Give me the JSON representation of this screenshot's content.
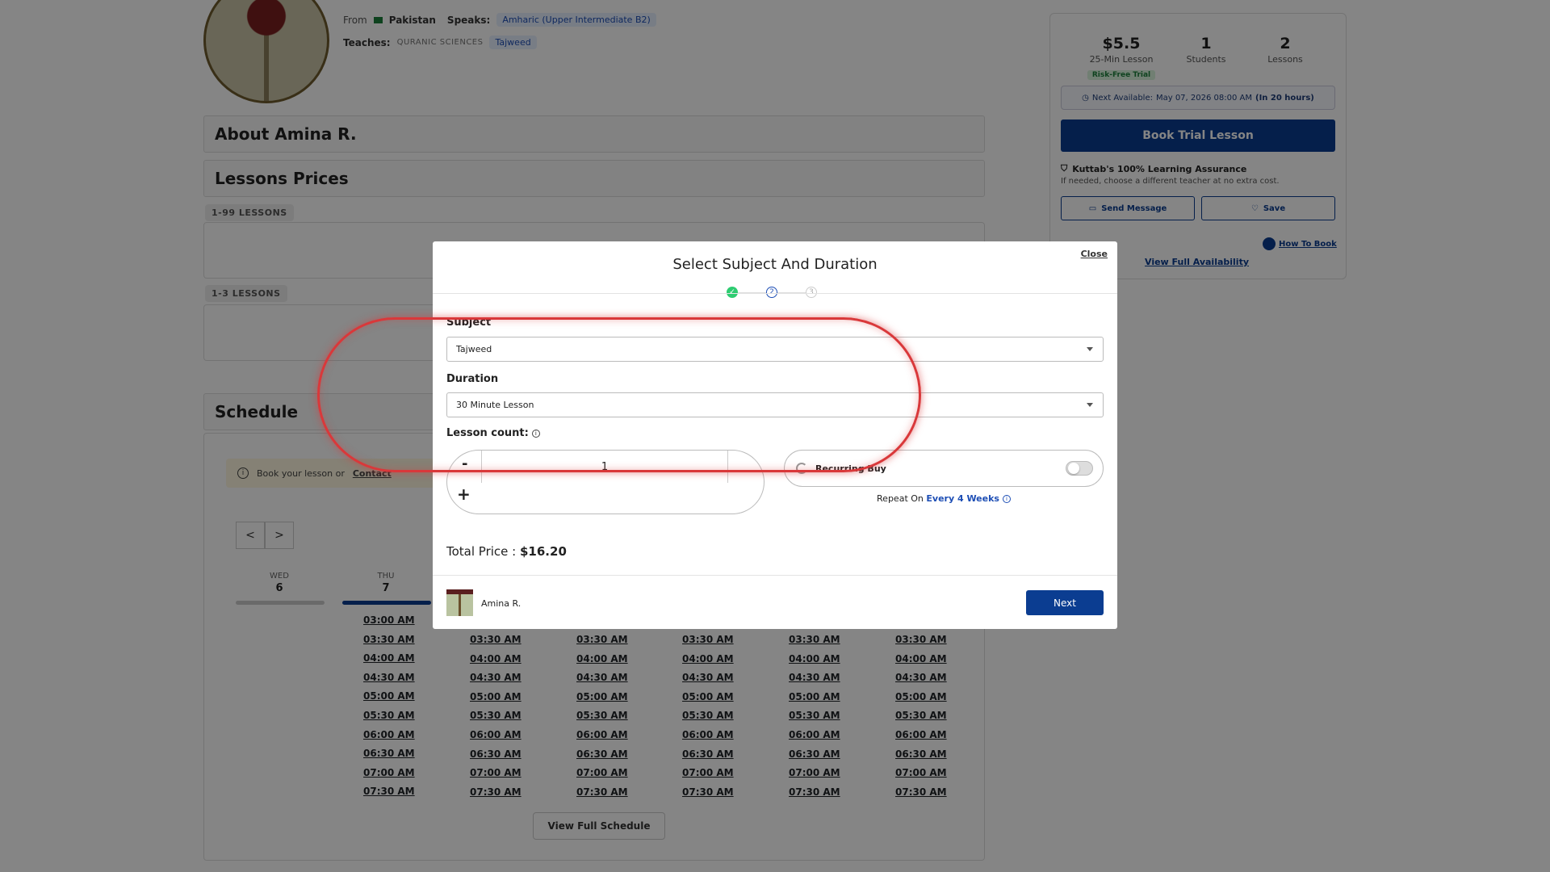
{
  "profile": {
    "from_label": "From",
    "country": "Pakistan",
    "speaks_label": "Speaks:",
    "language": "Amharic (Upper Intermediate B2)",
    "teaches_label": "Teaches:",
    "teaches_category": "QURANIC SCIENCES",
    "teaches_subject": "Tajweed"
  },
  "sections": {
    "about": "About Amina R.",
    "prices": "Lessons Prices",
    "tier1": "1-99 LESSONS",
    "tier2": "1-3 LESSONS",
    "schedule": "Schedule"
  },
  "schedule": {
    "notice_prefix": "Book your lesson or",
    "notice_link": "Contact",
    "prev": "<",
    "next": ">",
    "days": [
      {
        "dow": "WED",
        "num": "6"
      },
      {
        "dow": "THU",
        "num": "7"
      }
    ],
    "col1_times": [
      "03:00 AM",
      "03:30 AM",
      "04:00 AM",
      "04:30 AM",
      "05:00 AM",
      "05:30 AM",
      "06:00 AM",
      "06:30 AM",
      "07:00 AM",
      "07:30 AM"
    ],
    "col_times": [
      "03:30 AM",
      "04:00 AM",
      "04:30 AM",
      "05:00 AM",
      "05:30 AM",
      "06:00 AM",
      "06:30 AM",
      "07:00 AM",
      "07:30 AM"
    ],
    "view_full": "View Full Schedule"
  },
  "booking": {
    "price": "$5.5",
    "price_label": "25-Min Lesson",
    "trial_tag": "Risk-Free Trial",
    "students": "1",
    "students_label": "Students",
    "lessons": "2",
    "lessons_label": "Lessons",
    "next_available_label": "Next Available:",
    "next_available_value": "May 07, 2026 08:00 AM",
    "next_available_rel": "(In 20 hours)",
    "book_button": "Book Trial Lesson",
    "assurance_title": "Kuttab's 100% Learning Assurance",
    "assurance_sub": "If needed, choose a different teacher at no extra cost.",
    "send_message": "Send Message",
    "save": "Save",
    "how_to_book": "How To Book",
    "view_availability": "View Full Availability"
  },
  "modal": {
    "title": "Select Subject And Duration",
    "close": "Close",
    "steps": [
      "✓",
      "2",
      "3"
    ],
    "subject_label": "Subject",
    "subject_value": "Tajweed",
    "duration_label": "Duration",
    "duration_value": "30 Minute Lesson",
    "lesson_count_label": "Lesson count:",
    "count_minus": "-",
    "count_value": "1",
    "count_plus": "+",
    "recurring_label": "Recurring Buy",
    "recurring_on": false,
    "repeat_prefix": "Repeat On",
    "repeat_value": "Every 4 Weeks",
    "total_label": "Total Price :",
    "total_value": "$16.20",
    "teacher_name": "Amina R.",
    "next_button": "Next"
  },
  "colors": {
    "primary": "#0b3d91",
    "accent_blue": "#1d4eb5",
    "success": "#2ecc71",
    "annotation": "#d9383a"
  }
}
